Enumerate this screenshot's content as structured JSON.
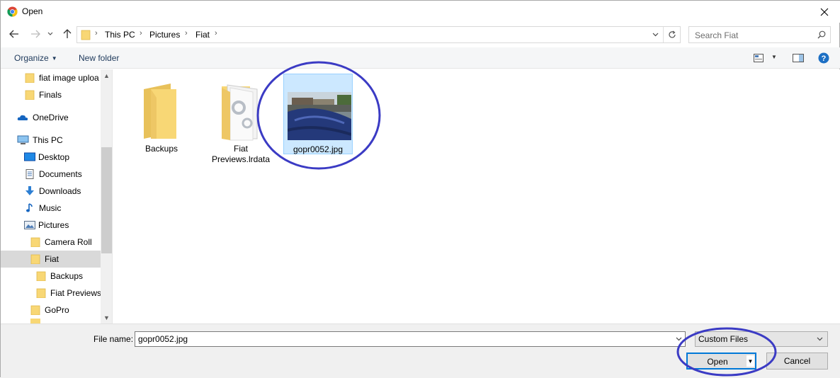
{
  "window": {
    "title": "Open"
  },
  "nav": {
    "breadcrumb": [
      "This PC",
      "Pictures",
      "Fiat"
    ],
    "search_placeholder": "Search Fiat"
  },
  "toolbar": {
    "organize_label": "Organize",
    "new_folder_label": "New folder"
  },
  "sidebar": {
    "items": [
      {
        "label": "fiat image uploa",
        "icon": "folder-icon"
      },
      {
        "label": "Finals",
        "icon": "folder-icon"
      },
      {
        "label": "OneDrive",
        "icon": "onedrive-icon"
      },
      {
        "label": "This PC",
        "icon": "computer-icon"
      },
      {
        "label": "Desktop",
        "icon": "desktop-icon"
      },
      {
        "label": "Documents",
        "icon": "documents-icon"
      },
      {
        "label": "Downloads",
        "icon": "downloads-icon"
      },
      {
        "label": "Music",
        "icon": "music-icon"
      },
      {
        "label": "Pictures",
        "icon": "pictures-icon"
      },
      {
        "label": "Camera Roll",
        "icon": "folder-icon"
      },
      {
        "label": "Fiat",
        "icon": "folder-icon",
        "selected": true
      },
      {
        "label": "Backups",
        "icon": "folder-icon"
      },
      {
        "label": "Fiat Previews.",
        "icon": "folder-icon"
      },
      {
        "label": "GoPro",
        "icon": "folder-icon"
      }
    ]
  },
  "files": [
    {
      "name": "Backups",
      "type": "folder"
    },
    {
      "name_line1": "Fiat",
      "name_line2": "Previews.lrdata",
      "type": "folder-settings"
    },
    {
      "name": "gopr0052.jpg",
      "type": "image",
      "selected": true
    }
  ],
  "bottom": {
    "file_name_label": "File name:",
    "file_name_value": "gopr0052.jpg",
    "file_type_value": "Custom Files",
    "open_label": "Open",
    "cancel_label": "Cancel"
  },
  "colors": {
    "accent": "#0078d7",
    "folder": "#f8d775",
    "annotation": "#3b3bc4",
    "selection": "#cce8ff"
  }
}
